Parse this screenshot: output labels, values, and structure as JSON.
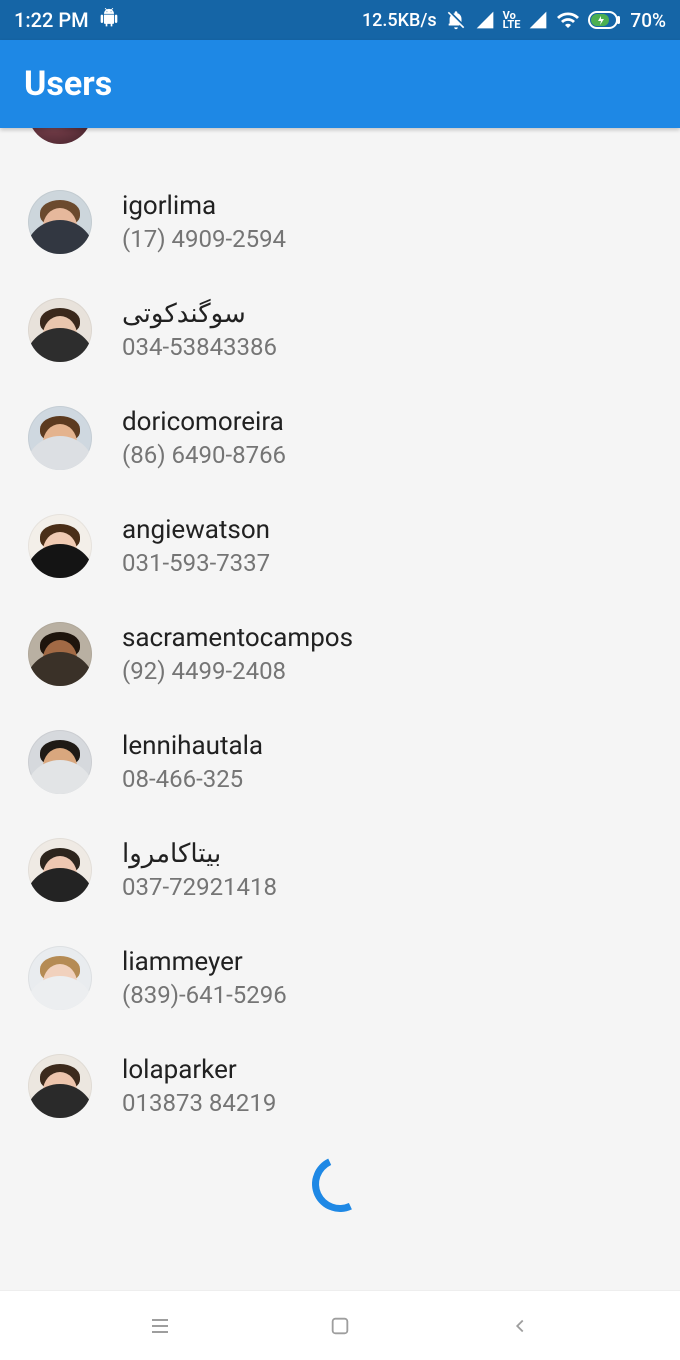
{
  "status": {
    "time": "1:22 PM",
    "net_speed": "12.5KB/s",
    "battery_pct": "70%",
    "volte": "Vo\nLTE"
  },
  "header": {
    "title": "Users"
  },
  "users": [
    {
      "name": "igorlima",
      "phone": "(17) 4909-2594"
    },
    {
      "name": "سوگندکوتی",
      "phone": "034-53843386"
    },
    {
      "name": "doricomoreira",
      "phone": "(86) 6490-8766"
    },
    {
      "name": "angiewatson",
      "phone": "031-593-7337"
    },
    {
      "name": "sacramentocampos",
      "phone": "(92) 4499-2408"
    },
    {
      "name": "lennihautala",
      "phone": "08-466-325"
    },
    {
      "name": "بیتاکامروا",
      "phone": "037-72921418"
    },
    {
      "name": "liammeyer",
      "phone": "(839)-641-5296"
    },
    {
      "name": "lolaparker",
      "phone": "013873 84219"
    }
  ]
}
